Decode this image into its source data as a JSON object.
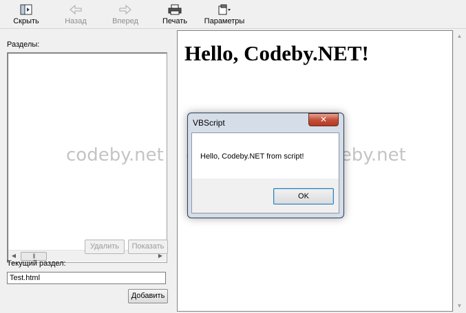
{
  "toolbar": {
    "hide_label": "Скрыть",
    "back_label": "Назад",
    "forward_label": "Вперед",
    "print_label": "Печать",
    "options_label": "Параметры"
  },
  "left_pane": {
    "sections_label": "Разделы:",
    "delete_label": "Удалить",
    "show_label": "Показать",
    "current_section_label": "Текущий раздел:",
    "current_section_value": "Test.html",
    "add_label": "Добавить"
  },
  "content": {
    "heading": "Hello, Codeby.NET!"
  },
  "watermark": {
    "text": "codeby.net"
  },
  "dialog": {
    "title": "VBScript",
    "close_glyph": "✕",
    "message": "Hello, Codeby.NET from script!",
    "ok_label": "OK"
  },
  "icons": [
    "hide-icon",
    "back-arrow-icon",
    "forward-arrow-icon",
    "printer-icon",
    "options-icon",
    "scroll-left-icon",
    "scroll-right-icon",
    "scroll-up-icon",
    "scroll-down-icon"
  ]
}
